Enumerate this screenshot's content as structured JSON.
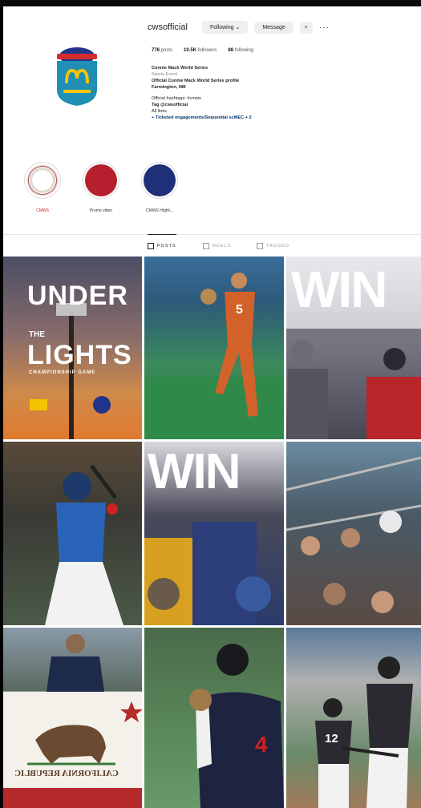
{
  "profile": {
    "username": "cwsofficial",
    "following_label": "Following",
    "message_label": "Message",
    "stats": {
      "posts_count": "776",
      "posts_label": "posts",
      "followers_count": "10.5K",
      "followers_label": "followers",
      "following_count": "88",
      "following_label": "following"
    },
    "bio": {
      "name": "Connie Mack World Series",
      "category": "Sports Event",
      "line1": "Official Connie Mack World Series profile",
      "line2": "Farmington, NM",
      "line3": "Official hashtags: #cmws",
      "line4": "Tag @cwsofficial",
      "line5": "All links",
      "link": "Ticketed engagements/Sequential scMEC + 2"
    }
  },
  "highlights": [
    {
      "label": "CMWS",
      "color": "#f0ece8"
    },
    {
      "label": "Promo video",
      "color": "#b51f2e"
    },
    {
      "label": "CMWS Highli...",
      "color": "#1f2f78"
    }
  ],
  "tabs": [
    {
      "label": "POSTS"
    },
    {
      "label": "REELS"
    },
    {
      "label": "TAGGED"
    }
  ],
  "posts": {
    "under_word": "UNDER",
    "the_word": "THE",
    "lights_word": "LIGHTS",
    "subtitle": "CHAMPIONSHIP GAME",
    "win_word": "WIN",
    "jersey_5": "5",
    "jersey_4": "4",
    "jersey_12": "12",
    "flag_text": "CALIFORNIA REPUBLIC"
  }
}
